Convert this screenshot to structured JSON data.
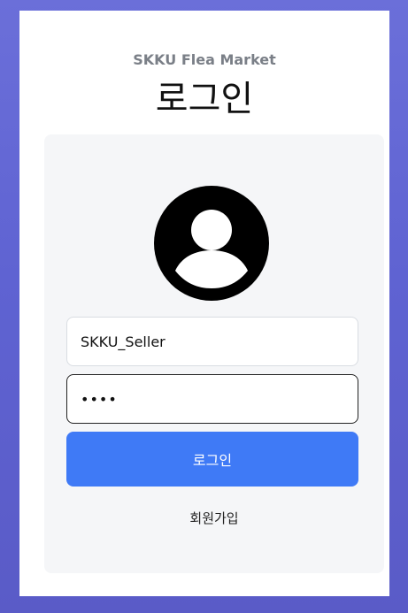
{
  "app": {
    "brand": "SKKU Flea Market",
    "title": "로그인"
  },
  "login_form": {
    "username_value": "SKKU_Seller",
    "password_value": "••••",
    "submit_label": "로그인",
    "signup_label": "회원가입"
  },
  "icons": {
    "avatar": "user-circle-icon"
  },
  "colors": {
    "primary": "#3f7af6",
    "background": "#6066d3",
    "panel": "#f5f6f8"
  }
}
